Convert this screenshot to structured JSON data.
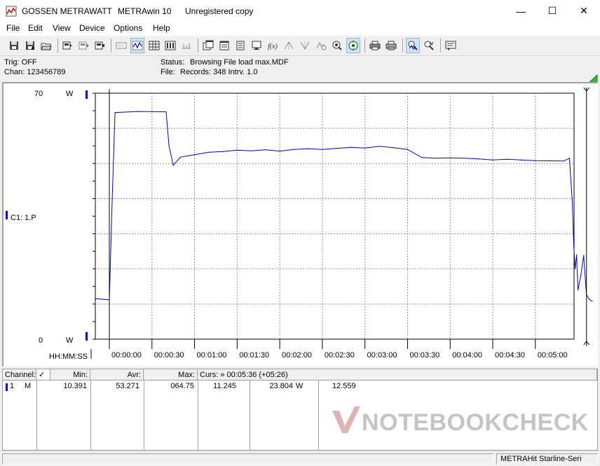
{
  "window": {
    "app_name": "GOSSEN METRAWATT",
    "product": "METRAwin 10",
    "license": "Unregistered copy",
    "minimize_glyph": "—",
    "maximize_glyph": "☐",
    "close_glyph": "✕"
  },
  "menu": {
    "items": [
      "File",
      "Edit",
      "View",
      "Device",
      "Options",
      "Help"
    ]
  },
  "toolbar": {
    "buttons": [
      {
        "icon": "save-icon"
      },
      {
        "icon": "save-as-icon"
      },
      {
        "icon": "open-icon"
      },
      {
        "icon": "device-read-icon"
      },
      {
        "icon": "device-config-icon"
      },
      {
        "icon": "device-stop-icon"
      },
      {
        "icon": "keyboard-icon"
      },
      {
        "icon": "waveform-view-icon",
        "active": true
      },
      {
        "icon": "table-view-icon"
      },
      {
        "icon": "bar-view-icon"
      },
      {
        "icon": "copy-window-icon"
      },
      {
        "icon": "window-list-icon"
      },
      {
        "icon": "clipboard-icon"
      },
      {
        "icon": "monitor-icon"
      },
      {
        "icon": "fx-icon"
      },
      {
        "icon": "peak-marker-icon"
      },
      {
        "icon": "valley-marker-icon"
      },
      {
        "icon": "zoom-target-icon"
      },
      {
        "icon": "record-target-icon",
        "active": true
      },
      {
        "icon": "print-icon"
      },
      {
        "icon": "print-preview-icon"
      },
      {
        "icon": "zoom-scale-icon",
        "active": true
      },
      {
        "icon": "cursor-zoom-icon"
      },
      {
        "icon": "comment-icon"
      }
    ],
    "trend_icon": "trend-triangle-icon"
  },
  "info": {
    "trig": "Trig: OFF",
    "chan": "Chan:  123456789",
    "status_label": "Status:",
    "status_value": "Browsing File load max.MDF",
    "file_label": "File:",
    "file_value": "Records: 348   Intrv. 1.0"
  },
  "chart": {
    "y_top_label": "70",
    "y_top_unit": "W",
    "y_bottom_label": "0",
    "y_bottom_unit": "W",
    "channel_label": "C1: 1.P",
    "x_axis_title": "HH:MM:SS",
    "trace_color": "#0000c0",
    "cursor_color": "#000000"
  },
  "chart_data": {
    "type": "line",
    "xlabel": "HH:MM:SS",
    "ylabel": "W",
    "ylim": [
      0,
      70
    ],
    "grid": true,
    "x_ticks": [
      "00:00:00",
      "00:00:30",
      "00:01:00",
      "00:01:30",
      "00:02:00",
      "00:02:30",
      "00:03:00",
      "00:03:30",
      "00:04:00",
      "00:04:30",
      "00:05:00"
    ],
    "series": [
      {
        "name": "C1: 1.P",
        "x": [
          -10,
          0,
          2,
          4,
          20,
          40,
          42,
          45,
          50,
          60,
          70,
          80,
          90,
          100,
          110,
          120,
          130,
          140,
          150,
          160,
          170,
          180,
          190,
          200,
          210,
          220,
          230,
          240,
          250,
          260,
          270,
          280,
          290,
          300,
          320,
          324,
          326,
          327,
          328,
          329,
          330,
          332,
          334,
          336,
          338,
          340
        ],
        "y": [
          11.5,
          11.2,
          40,
          64.5,
          64.8,
          64.7,
          55,
          49.5,
          51.8,
          52.5,
          53.2,
          53.4,
          53.8,
          53.6,
          53.9,
          53.5,
          54.0,
          54.2,
          54.0,
          54.3,
          54.6,
          54.4,
          54.9,
          54.5,
          54.0,
          51.7,
          51.5,
          51.6,
          51.5,
          51.3,
          51.0,
          51.2,
          51.0,
          50.8,
          50.7,
          51.5,
          39,
          27,
          20,
          24,
          14,
          18,
          23.8,
          12.6,
          11.3,
          10.8
        ]
      }
    ],
    "cursor_x": 336,
    "summary": {
      "min": "10.391",
      "avr": "53.271",
      "max": "064.75",
      "cursor_value": "11.245",
      "cursor_value2": "23.804",
      "unit": "W",
      "delta": "12.559"
    }
  },
  "table": {
    "headers": {
      "channel": "Channel:",
      "check": "✓",
      "min": "Min:",
      "avr": "Avr:",
      "max": "Max:",
      "curs": "Curs: » 00:05:36 (+05:26)"
    },
    "row": {
      "index": "1",
      "mode": "M",
      "min": "10.391",
      "avr": "53.271",
      "max": "064.75",
      "c1": "11.245",
      "c2": "23.804",
      "unit": "W",
      "c3": "12.559"
    }
  },
  "watermark": {
    "text": "NOTEBOOKCHECK"
  },
  "statusbar": {
    "device": "METRAHit Starline-Seri"
  }
}
